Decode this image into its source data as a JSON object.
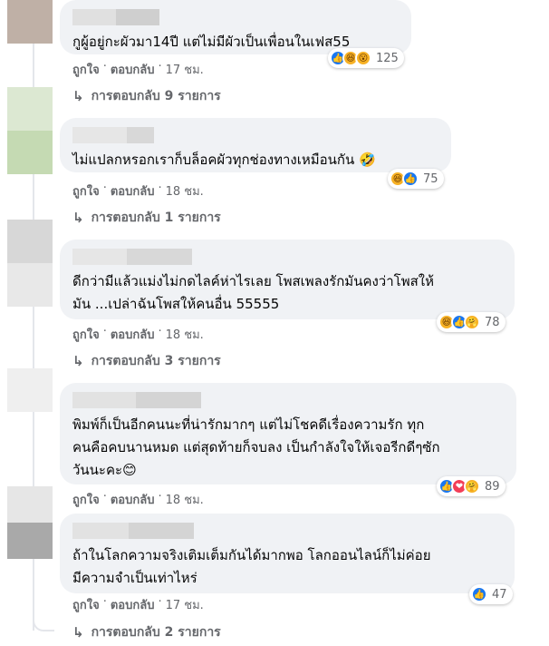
{
  "comments": [
    {
      "text": "กูผู้อยู่กะผัวมา14ปี แต่ไม่มีผัวเป็นเพื่อนในเฟส55",
      "reactions": [
        "like",
        "haha",
        "wow"
      ],
      "reaction_count": "125",
      "like_label": "ถูกใจ",
      "reply_label": "ตอบกลับ",
      "time": "17 ชม.",
      "replies_label": "การตอบกลับ 9 รายการ"
    },
    {
      "text": "ไม่แปลกหรอกเราก็บล็อคผัวทุกช่องทางเหมือนกัน 🤣",
      "reactions": [
        "haha",
        "like"
      ],
      "reaction_count": "75",
      "like_label": "ถูกใจ",
      "reply_label": "ตอบกลับ",
      "time": "18 ชม.",
      "replies_label": "การตอบกลับ 1 รายการ"
    },
    {
      "text": "ดีกว่ามีแล้วแม่งไม่กดไลค์ห่าไรเลย โพสเพลงรักมันคงว่าโพสให้\nมัน ...เปล่าฉันโพสให้คนอื่น 55555",
      "reactions": [
        "haha",
        "like",
        "care"
      ],
      "reaction_count": "78",
      "like_label": "ถูกใจ",
      "reply_label": "ตอบกลับ",
      "time": "18 ชม.",
      "replies_label": "การตอบกลับ 3 รายการ"
    },
    {
      "text": "พิมพ์ก็เป็นอีกคนนะที่น่ารักมากๆ แต่ไม่โชคดีเรื่องความรัก ทุก\nคนคือคบนานหมด แต่สุดท้ายก็จบลง เป็นกำลังใจให้เจอรีกดีๆซัก\nวันนะคะ😊",
      "reactions": [
        "like",
        "love",
        "care"
      ],
      "reaction_count": "89",
      "like_label": "ถูกใจ",
      "reply_label": "ตอบกลับ",
      "time": "18 ชม."
    },
    {
      "text": "ถ้าในโลกความจริงเติมเต็มกันได้มากพอ โลกออนไลน์ก็ไม่ค่อย\nมีความจำเป็นเท่าไหร่",
      "reactions": [
        "like"
      ],
      "reaction_count": "47",
      "like_label": "ถูกใจ",
      "reply_label": "ตอบกลับ",
      "time": "17 ชม.",
      "replies_label": "การตอบกลับ 2 รายการ"
    }
  ],
  "separator": "·",
  "reply_arrow": "↳",
  "icons": {
    "like": "👍",
    "haha": "😆",
    "wow": "😮",
    "love": "❤",
    "care": "🤗"
  }
}
